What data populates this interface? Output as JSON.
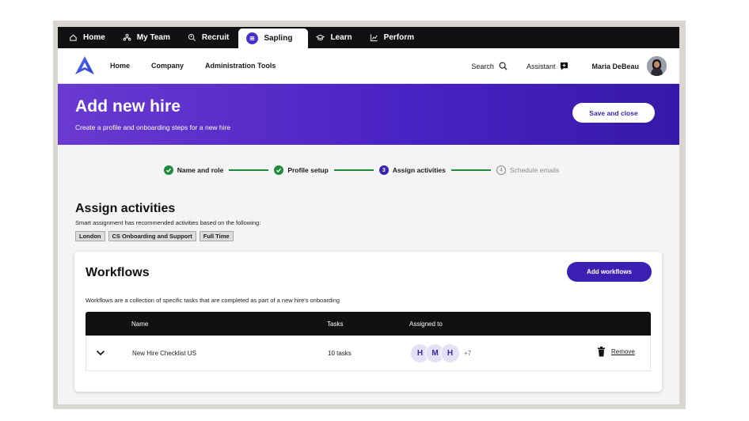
{
  "app_tabs": [
    {
      "label": "Home",
      "icon": "home-icon"
    },
    {
      "label": "My Team",
      "icon": "team-icon"
    },
    {
      "label": "Recruit",
      "icon": "recruit-icon"
    },
    {
      "label": "Sapling",
      "icon": "sapling-icon",
      "active": true
    },
    {
      "label": "Learn",
      "icon": "graduation-cap-icon"
    },
    {
      "label": "Perform",
      "icon": "chart-icon"
    }
  ],
  "nav": {
    "links": [
      "Home",
      "Company",
      "Administration Tools"
    ],
    "search_label": "Search",
    "assistant_label": "Assistant",
    "user_name": "Maria DeBeau"
  },
  "hero": {
    "title": "Add new hire",
    "subtitle": "Create a profile and onboarding steps for a new hire",
    "save_label": "Save and close"
  },
  "stepper": {
    "steps": [
      {
        "label": "Name and role",
        "status": "done"
      },
      {
        "label": "Profile setup",
        "status": "done"
      },
      {
        "label": "Assign activities",
        "status": "current",
        "number": "3"
      },
      {
        "label": "Schedule emails",
        "status": "pending",
        "number": "4"
      }
    ]
  },
  "assign": {
    "title": "Assign activities",
    "subtitle": "Smart assignment has recommended activities based on the following:",
    "chips": [
      "London",
      "CS Onboarding and Support",
      "Full Time"
    ]
  },
  "workflows": {
    "title": "Workflows",
    "add_label": "Add workflows",
    "description": "Workflows are a collection of specific tasks that are completed as part of a new hire's onboarding",
    "columns": {
      "name": "Name",
      "tasks": "Tasks",
      "assigned": "Assigned to"
    },
    "rows": [
      {
        "name": "New Hire Checklist US",
        "tasks": "10 tasks",
        "assignees": [
          "H",
          "M",
          "H"
        ],
        "more": "+7",
        "remove_label": "Remove"
      }
    ]
  },
  "colors": {
    "brand_purple": "#3c1fb3",
    "done_green": "#1e8a3a",
    "header_black": "#111111"
  }
}
